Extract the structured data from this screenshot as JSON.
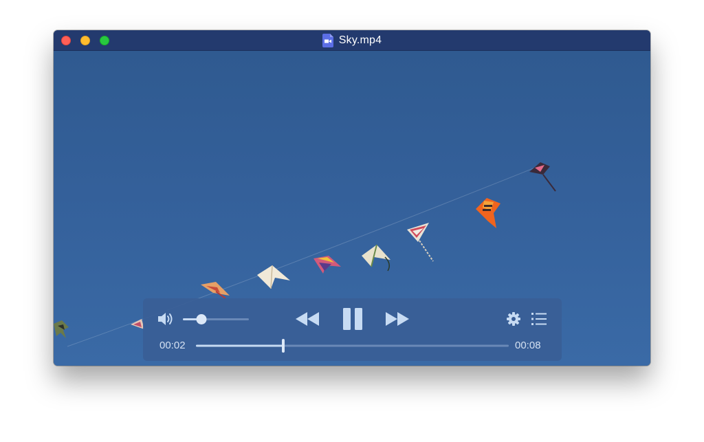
{
  "window": {
    "title": "Sky.mp4"
  },
  "player": {
    "current_time": "00:02",
    "duration": "00:08",
    "progress_fraction": 0.28,
    "volume_fraction": 0.28,
    "state": "playing"
  },
  "icons": {
    "file": "video-file-icon",
    "volume": "speaker-icon",
    "rewind": "rewind-icon",
    "pause": "pause-icon",
    "forward": "fast-forward-icon",
    "settings": "gear-icon",
    "playlist": "list-icon"
  },
  "colors": {
    "titlebar": "#233a6e",
    "sky": "#2f5a90",
    "controls_bg": "#395e96",
    "icon": "#c7dbf3",
    "close": "#fe5f57",
    "minimize": "#febc2e",
    "maximize": "#28c840"
  }
}
